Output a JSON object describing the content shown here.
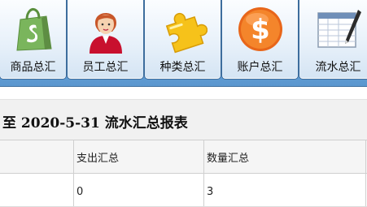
{
  "toolbar": {
    "buttons": [
      {
        "label": "商品总汇",
        "icon": "shopping-bag-icon"
      },
      {
        "label": "员工总汇",
        "icon": "employee-person-icon"
      },
      {
        "label": "种类总汇",
        "icon": "puzzle-piece-icon"
      },
      {
        "label": "账户总汇",
        "icon": "dollar-coin-icon"
      },
      {
        "label": "流水总汇",
        "icon": "spreadsheet-pen-icon"
      }
    ]
  },
  "report": {
    "title": "至 2020-5-31 流水汇总报表"
  },
  "table": {
    "columns": [
      "",
      "支出汇总",
      "数量汇总"
    ],
    "rows": [
      [
        "",
        "0",
        "3"
      ]
    ]
  },
  "colors": {
    "toolbar_bg": "#6fa9dd",
    "shopify_green": "#7ab55c",
    "coin_orange": "#f07a1e",
    "puzzle_yellow": "#f6c21a"
  }
}
